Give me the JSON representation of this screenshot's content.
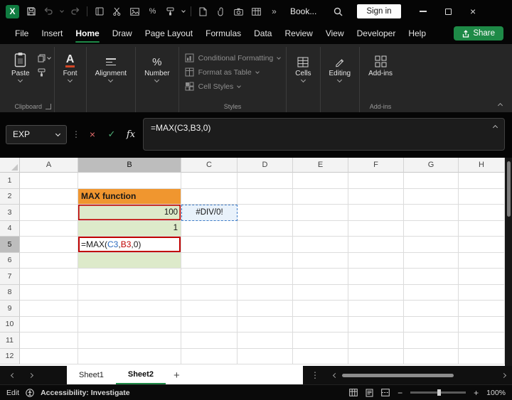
{
  "colors": {
    "accent_green": "#1E8A47",
    "excel_green": "#107C41",
    "orange_fill": "#F0962F",
    "green_fill": "#DDEACA",
    "blue_fill": "#E9F2FB",
    "blue_ref": "#3E7BC6",
    "red_ref": "#C00000"
  },
  "icons": {
    "excel_logo_letter": "X",
    "percent": "%",
    "more": "»",
    "close": "×",
    "cancel": "×",
    "check": "✓",
    "fx": "fx",
    "dots": "⋮",
    "add_sheet": "+",
    "zoom_out": "−",
    "zoom_in": "+"
  },
  "titlebar": {
    "doc_title": "Book...",
    "sign_in_label": "Sign in"
  },
  "menubar": {
    "items": [
      "File",
      "Insert",
      "Home",
      "Draw",
      "Page Layout",
      "Formulas",
      "Data",
      "Review",
      "View",
      "Developer",
      "Help"
    ],
    "active_item": "Home",
    "share_label": "Share"
  },
  "ribbon": {
    "paste_label": "Paste",
    "font_label": "Font",
    "alignment_label": "Alignment",
    "number_label": "Number",
    "styles_buttons": [
      "Conditional Formatting",
      "Format as Table",
      "Cell Styles"
    ],
    "cells_label": "Cells",
    "editing_label": "Editing",
    "addins_label": "Add-ins",
    "group_labels": {
      "clipboard": "Clipboard",
      "styles": "Styles",
      "addins": "Add-ins"
    }
  },
  "formula_bar": {
    "name_box_value": "EXP",
    "formula": "=MAX(C3,B3,0)"
  },
  "grid": {
    "col_headers": [
      "A",
      "B",
      "C",
      "D",
      "E",
      "F",
      "G",
      "H"
    ],
    "row_headers": [
      "1",
      "2",
      "3",
      "4",
      "5",
      "6",
      "7",
      "8",
      "9",
      "10",
      "11",
      "12"
    ],
    "selected_col": "B",
    "selected_row": "5",
    "cells": {
      "B2": {
        "text": "MAX function",
        "style": "orange"
      },
      "B3": {
        "text": "100",
        "style": "greenfill num refred"
      },
      "C3": {
        "text": "#DIV/0!",
        "style": "refblue"
      },
      "B4": {
        "text": "1",
        "style": "greenfill num"
      },
      "B5": {
        "style": "editcell",
        "parts": [
          {
            "t": "=MAX(",
            "c": "#1a1a1a"
          },
          {
            "t": "C3",
            "c": "#2B6BC0"
          },
          {
            "t": ",",
            "c": "#1a1a1a"
          },
          {
            "t": "B3",
            "c": "#C00000"
          },
          {
            "t": ",0)",
            "c": "#1a1a1a"
          }
        ]
      },
      "B6": {
        "text": "",
        "style": "greenfill"
      }
    }
  },
  "sheet_tabs": {
    "tabs": [
      "Sheet1",
      "Sheet2"
    ],
    "active_tab": "Sheet2"
  },
  "status_bar": {
    "mode": "Edit",
    "accessibility_label": "Accessibility: Investigate",
    "zoom_level": "100%"
  }
}
